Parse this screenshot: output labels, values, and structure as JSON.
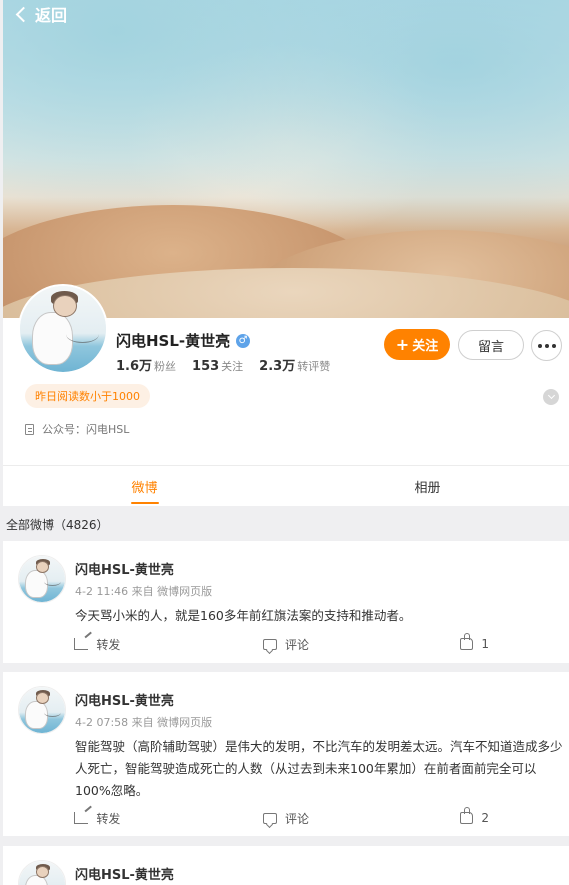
{
  "nav": {
    "back_label": "返回"
  },
  "profile": {
    "name": "闪电HSL-黄世亮",
    "verify_symbol": "♂",
    "stats": [
      {
        "num": "1.6万",
        "label": "粉丝"
      },
      {
        "num": "153",
        "label": "关注"
      },
      {
        "num": "2.3万",
        "label": "转评赞"
      }
    ],
    "follow_label": "关注",
    "follow_plus": "+",
    "message_label": "留言",
    "read_badge": "昨日阅读数小于1000",
    "account_label": "公众号：闪电HSL"
  },
  "tabs": [
    {
      "label": "微博",
      "active": true
    },
    {
      "label": "相册",
      "active": false
    }
  ],
  "feed": {
    "section_title": "全部微博（4826）",
    "posts": [
      {
        "author": "闪电HSL-黄世亮",
        "meta": "4-2 11:46 来自 微博网页版",
        "text": "今天骂小米的人，就是160多年前红旗法案的支持和推动者。",
        "repost_label": "转发",
        "comment_label": "评论",
        "like_count": "1"
      },
      {
        "author": "闪电HSL-黄世亮",
        "meta": "4-2 07:58 来自 微博网页版",
        "text": "智能驾驶（高阶辅助驾驶）是伟大的发明，不比汽车的发明差太远。汽车不知道造成多少人死亡，智能驾驶造成死亡的人数（从过去到未来100年累加）在前者面前完全可以100%忽略。",
        "repost_label": "转发",
        "comment_label": "评论",
        "like_count": "2"
      },
      {
        "author": "闪电HSL-黄世亮"
      }
    ]
  },
  "colors": {
    "accent": "#ff8200",
    "verify": "#5ea3e9",
    "background": "#efeff1"
  }
}
